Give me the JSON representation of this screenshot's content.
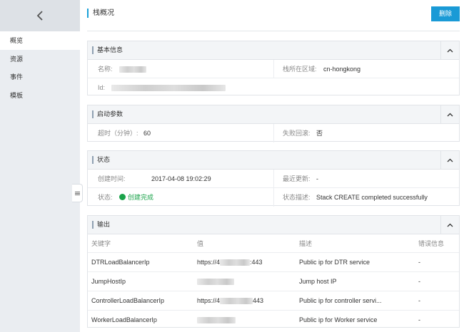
{
  "sidebar": {
    "back_icon": "chevron-left-icon",
    "items": [
      {
        "label": "概览",
        "active": true
      },
      {
        "label": "资源",
        "active": false
      },
      {
        "label": "事件",
        "active": false
      },
      {
        "label": "模板",
        "active": false
      }
    ]
  },
  "header": {
    "title": "栈概况",
    "delete_label": "删除",
    "accent": "#1a9ad6"
  },
  "basic_info": {
    "title": "基本信息",
    "name_label": "名称:",
    "name_value": "",
    "region_label": "栈所在区域:",
    "region_value": "cn-hongkong",
    "id_label": "Id:",
    "id_value": ""
  },
  "launch_params": {
    "title": "启动参数",
    "timeout_label": "超时（分钟）:",
    "timeout_value": "60",
    "rollback_label": "失败回滚:",
    "rollback_value": "否"
  },
  "status": {
    "title": "状态",
    "created_label": "创建时间:",
    "created_value": "2017-04-08 19:02:29",
    "updated_label": "最近更新:",
    "updated_value": "-",
    "state_label": "状态:",
    "state_value": "创建完成",
    "state_color": "#1aa34a",
    "desc_label": "状态描述:",
    "desc_value": "Stack CREATE completed successfully"
  },
  "outputs": {
    "title": "输出",
    "columns": [
      "关键字",
      "值",
      "描述",
      "错误信息"
    ],
    "rows": [
      {
        "key": "DTRLoadBalancerIp",
        "value_prefix": "https://4",
        "value_suffix": ":443",
        "desc": "Public ip for DTR service",
        "error": "-"
      },
      {
        "key": "JumpHostIp",
        "value_prefix": "",
        "value_suffix": "",
        "desc": "Jump host IP",
        "error": "-"
      },
      {
        "key": "ControllerLoadBalancerIp",
        "value_prefix": "https://4",
        "value_suffix": "443",
        "desc": "Public ip for controller servi...",
        "error": "-"
      },
      {
        "key": "WorkerLoadBalancerIp",
        "value_prefix": "",
        "value_suffix": "",
        "desc": "Public ip for Worker service",
        "error": "-"
      }
    ]
  }
}
